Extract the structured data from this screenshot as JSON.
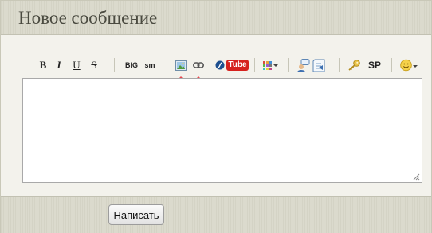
{
  "form": {
    "title": "Новое сообщение",
    "editor_value": "",
    "submit_label": "Написать"
  },
  "toolbar": {
    "bold": "B",
    "italic": "I",
    "underline": "U",
    "strike": "S",
    "big": "BIG",
    "small": "sm",
    "youtube": "Tube",
    "spoiler": "SP"
  },
  "icons": [
    "bold-icon",
    "italic-icon",
    "underline-icon",
    "strikethrough-icon",
    "big-text-icon",
    "small-text-icon",
    "insert-image-icon",
    "insert-link-icon",
    "flash-icon",
    "youtube-icon",
    "color-palette-icon",
    "quote-icon",
    "reply-icon",
    "key-icon",
    "spoiler-icon",
    "smiley-icon"
  ],
  "colors": {
    "accent_arrow": "#e8474e",
    "youtube_red": "#d6211d"
  }
}
